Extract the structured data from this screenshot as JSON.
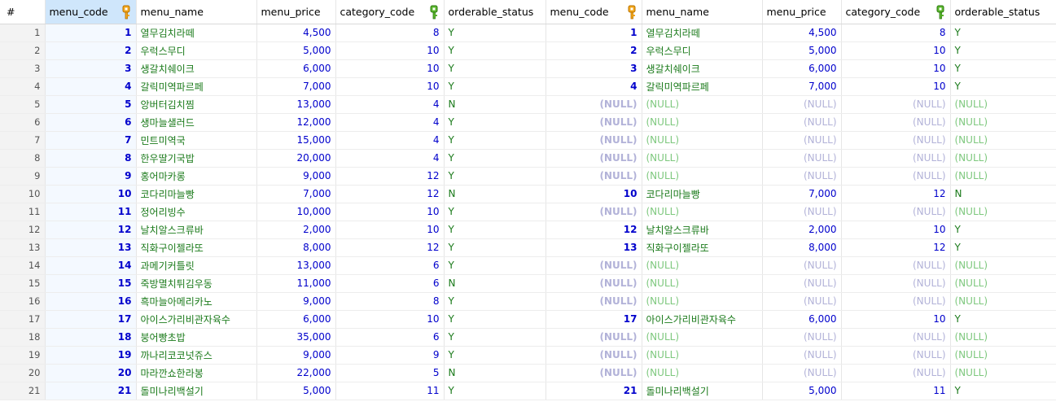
{
  "grid": {
    "headers": [
      "#",
      "menu_code",
      "menu_name",
      "menu_price",
      "category_code",
      "orderable_status",
      "menu_code",
      "menu_name",
      "menu_price",
      "category_code",
      "orderable_status"
    ],
    "null_text": "(NULL)",
    "rows": [
      {
        "n": "1",
        "code": "1",
        "name": "열무김치라떼",
        "price": "4,500",
        "cat": "8",
        "status": "Y",
        "r_code": "1",
        "r_name": "열무김치라떼",
        "r_price": "4,500",
        "r_cat": "8",
        "r_status": "Y"
      },
      {
        "n": "2",
        "code": "2",
        "name": "우럭스무디",
        "price": "5,000",
        "cat": "10",
        "status": "Y",
        "r_code": "2",
        "r_name": "우럭스무디",
        "r_price": "5,000",
        "r_cat": "10",
        "r_status": "Y"
      },
      {
        "n": "3",
        "code": "3",
        "name": "생갈치쉐이크",
        "price": "6,000",
        "cat": "10",
        "status": "Y",
        "r_code": "3",
        "r_name": "생갈치쉐이크",
        "r_price": "6,000",
        "r_cat": "10",
        "r_status": "Y"
      },
      {
        "n": "4",
        "code": "4",
        "name": "갈릭미역파르페",
        "price": "7,000",
        "cat": "10",
        "status": "Y",
        "r_code": "4",
        "r_name": "갈릭미역파르페",
        "r_price": "7,000",
        "r_cat": "10",
        "r_status": "Y"
      },
      {
        "n": "5",
        "code": "5",
        "name": "앙버터김치찜",
        "price": "13,000",
        "cat": "4",
        "status": "N",
        "r_code": null,
        "r_name": null,
        "r_price": null,
        "r_cat": null,
        "r_status": null
      },
      {
        "n": "6",
        "code": "6",
        "name": "생마늘샐러드",
        "price": "12,000",
        "cat": "4",
        "status": "Y",
        "r_code": null,
        "r_name": null,
        "r_price": null,
        "r_cat": null,
        "r_status": null
      },
      {
        "n": "7",
        "code": "7",
        "name": "민트미역국",
        "price": "15,000",
        "cat": "4",
        "status": "Y",
        "r_code": null,
        "r_name": null,
        "r_price": null,
        "r_cat": null,
        "r_status": null
      },
      {
        "n": "8",
        "code": "8",
        "name": "한우딸기국밥",
        "price": "20,000",
        "cat": "4",
        "status": "Y",
        "r_code": null,
        "r_name": null,
        "r_price": null,
        "r_cat": null,
        "r_status": null
      },
      {
        "n": "9",
        "code": "9",
        "name": "홍어마카롱",
        "price": "9,000",
        "cat": "12",
        "status": "Y",
        "r_code": null,
        "r_name": null,
        "r_price": null,
        "r_cat": null,
        "r_status": null
      },
      {
        "n": "10",
        "code": "10",
        "name": "코다리마늘빵",
        "price": "7,000",
        "cat": "12",
        "status": "N",
        "r_code": "10",
        "r_name": "코다리마늘빵",
        "r_price": "7,000",
        "r_cat": "12",
        "r_status": "N"
      },
      {
        "n": "11",
        "code": "11",
        "name": "정어리빙수",
        "price": "10,000",
        "cat": "10",
        "status": "Y",
        "r_code": null,
        "r_name": null,
        "r_price": null,
        "r_cat": null,
        "r_status": null
      },
      {
        "n": "12",
        "code": "12",
        "name": "날치알스크류바",
        "price": "2,000",
        "cat": "10",
        "status": "Y",
        "r_code": "12",
        "r_name": "날치알스크류바",
        "r_price": "2,000",
        "r_cat": "10",
        "r_status": "Y"
      },
      {
        "n": "13",
        "code": "13",
        "name": "직화구이젤라또",
        "price": "8,000",
        "cat": "12",
        "status": "Y",
        "r_code": "13",
        "r_name": "직화구이젤라또",
        "r_price": "8,000",
        "r_cat": "12",
        "r_status": "Y"
      },
      {
        "n": "14",
        "code": "14",
        "name": "과메기커틀릿",
        "price": "13,000",
        "cat": "6",
        "status": "Y",
        "r_code": null,
        "r_name": null,
        "r_price": null,
        "r_cat": null,
        "r_status": null
      },
      {
        "n": "15",
        "code": "15",
        "name": "죽방멸치튀김우동",
        "price": "11,000",
        "cat": "6",
        "status": "N",
        "r_code": null,
        "r_name": null,
        "r_price": null,
        "r_cat": null,
        "r_status": null
      },
      {
        "n": "16",
        "code": "16",
        "name": "흑마늘아메리카노",
        "price": "9,000",
        "cat": "8",
        "status": "Y",
        "r_code": null,
        "r_name": null,
        "r_price": null,
        "r_cat": null,
        "r_status": null
      },
      {
        "n": "17",
        "code": "17",
        "name": "아이스가리비관자육수",
        "price": "6,000",
        "cat": "10",
        "status": "Y",
        "r_code": "17",
        "r_name": "아이스가리비관자육수",
        "r_price": "6,000",
        "r_cat": "10",
        "r_status": "Y"
      },
      {
        "n": "18",
        "code": "18",
        "name": "붕어빵초밥",
        "price": "35,000",
        "cat": "6",
        "status": "Y",
        "r_code": null,
        "r_name": null,
        "r_price": null,
        "r_cat": null,
        "r_status": null
      },
      {
        "n": "19",
        "code": "19",
        "name": "까나리코코넛쥬스",
        "price": "9,000",
        "cat": "9",
        "status": "Y",
        "r_code": null,
        "r_name": null,
        "r_price": null,
        "r_cat": null,
        "r_status": null
      },
      {
        "n": "20",
        "code": "20",
        "name": "마라깐쇼한라봉",
        "price": "22,000",
        "cat": "5",
        "status": "N",
        "r_code": null,
        "r_name": null,
        "r_price": null,
        "r_cat": null,
        "r_status": null
      },
      {
        "n": "21",
        "code": "21",
        "name": "돌미나리백설기",
        "price": "5,000",
        "cat": "11",
        "status": "Y",
        "r_code": "21",
        "r_name": "돌미나리백설기",
        "r_price": "5,000",
        "r_cat": "11",
        "r_status": "Y"
      }
    ]
  }
}
